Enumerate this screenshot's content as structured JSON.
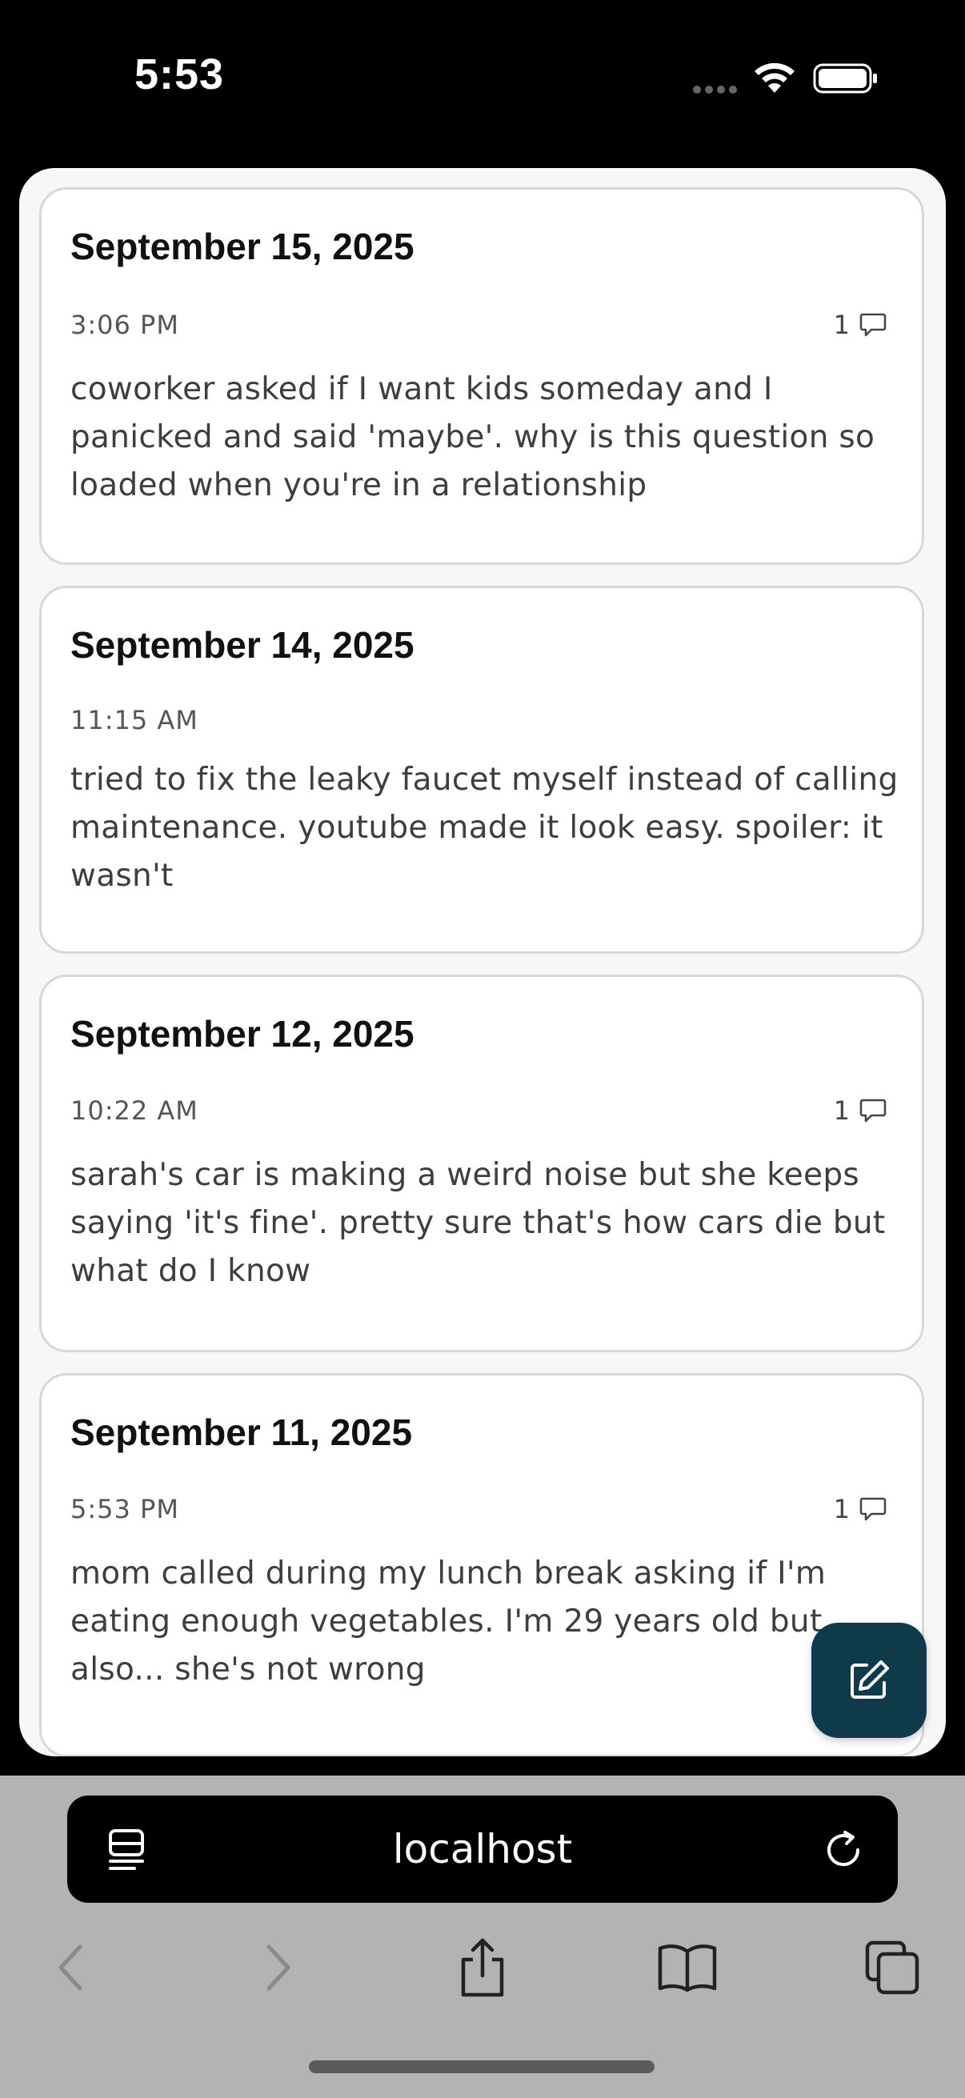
{
  "status_bar": {
    "time": "5:53",
    "icons": [
      "cellular-signal-icon",
      "wifi-icon",
      "battery-icon"
    ]
  },
  "entries": [
    {
      "date": "September 15, 2025",
      "time": "3:06 PM",
      "comment_count": "1",
      "text": "coworker asked if I want kids someday and I panicked and said 'maybe'. why is this question so loaded when you're in a relationship"
    },
    {
      "date": "September 14, 2025",
      "time": "11:15 AM",
      "comment_count": "",
      "text": "tried to fix the leaky faucet myself instead of calling maintenance. youtube made it look easy. spoiler: it wasn't"
    },
    {
      "date": "September 12, 2025",
      "time": "10:22 AM",
      "comment_count": "1",
      "text": "sarah's car is making a weird noise but she keeps saying 'it's fine'. pretty sure that's how cars die but what do I know"
    },
    {
      "date": "September 11, 2025",
      "time": "5:53 PM",
      "comment_count": "1",
      "text": "mom called during my lunch break asking if I'm eating enough vegetables. I'm 29 years old but also... she's not wrong"
    }
  ],
  "fab": {
    "icon": "compose-icon"
  },
  "browser": {
    "url": "localhost",
    "icons": [
      "tab-list-icon",
      "reload-icon",
      "back-icon",
      "forward-icon",
      "share-icon",
      "bookmarks-icon",
      "tabs-icon"
    ]
  },
  "colors": {
    "fab_background": "#0e3a4a",
    "chrome_background": "#b3b3b3"
  }
}
